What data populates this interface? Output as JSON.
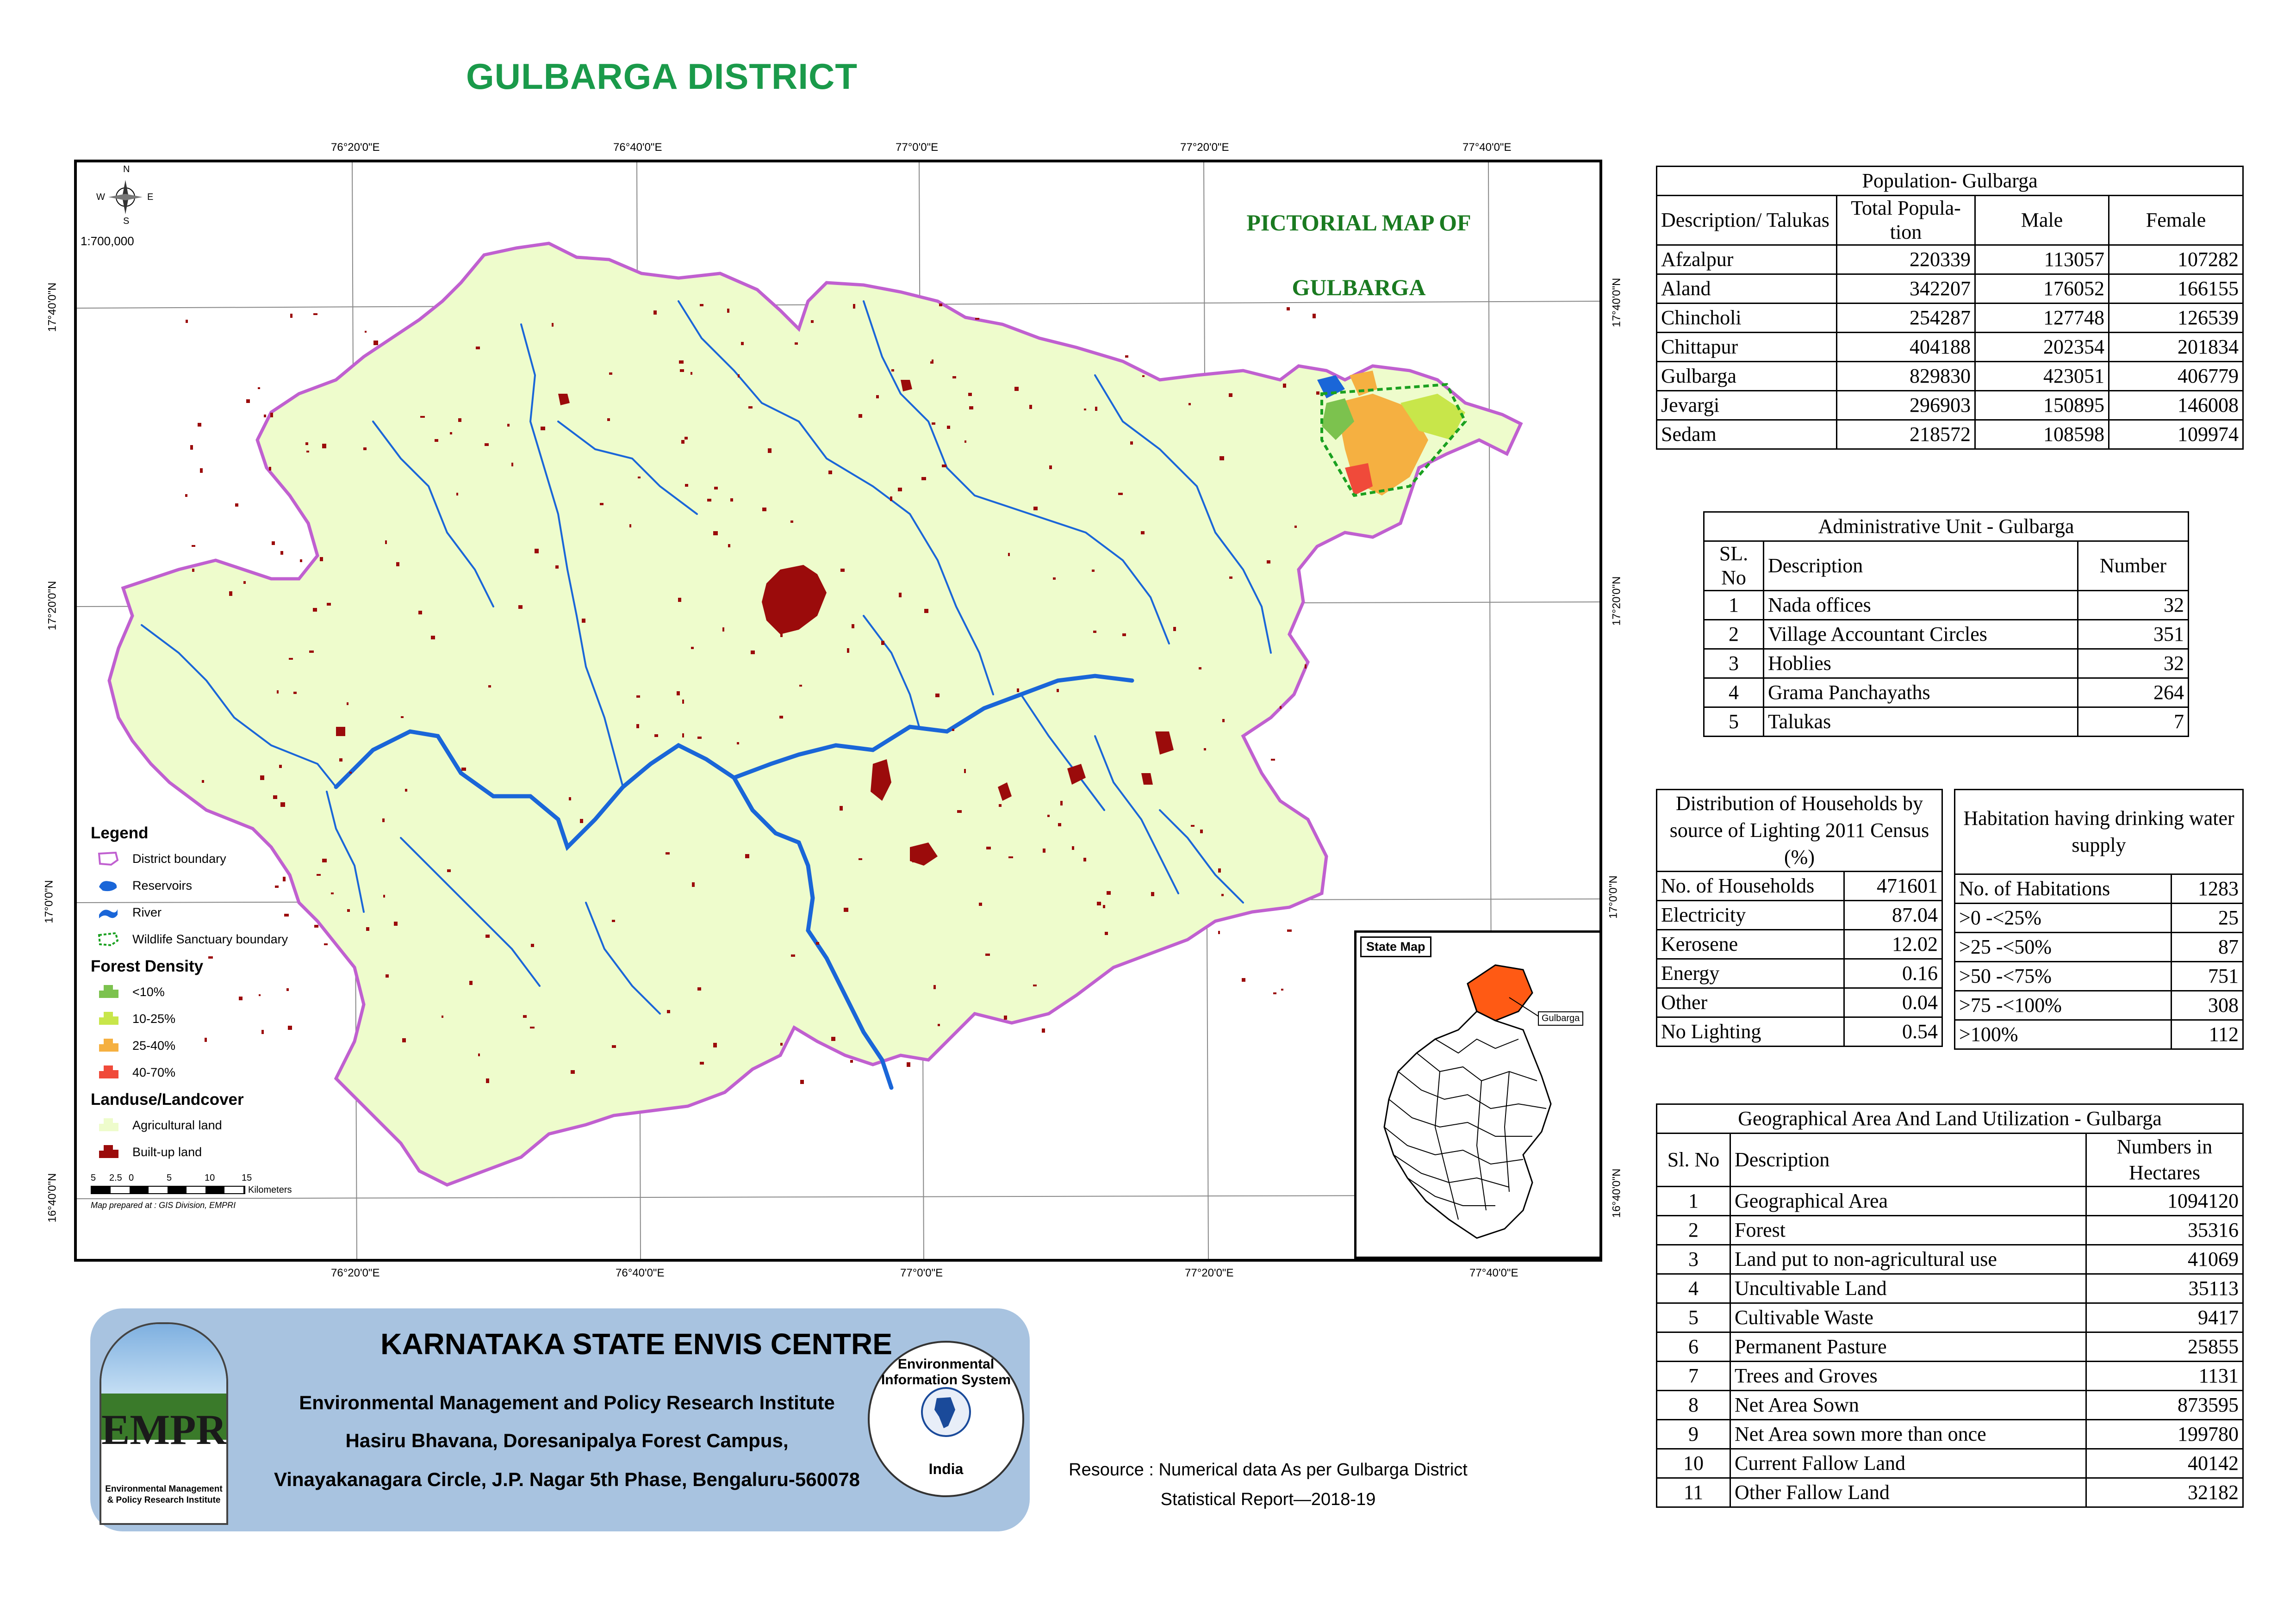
{
  "page_title": "GULBARGA DISTRICT",
  "map": {
    "title_line1": "PICTORIAL MAP OF",
    "title_line2": "GULBARGA",
    "scale": "1:700,000",
    "north_labels": {
      "n": "N",
      "s": "S",
      "e": "E",
      "w": "W"
    },
    "lon_labels": [
      "76°20'0\"E",
      "76°40'0\"E",
      "77°0'0\"E",
      "77°20'0\"E",
      "77°40'0\"E"
    ],
    "lat_labels": [
      "17°40'0\"N",
      "17°20'0\"N",
      "17°0'0\"N",
      "16°40'0\"N"
    ],
    "scalebar_ticks": [
      "5",
      "2.5",
      "0",
      "5",
      "10",
      "15"
    ],
    "scalebar_unit": "Kilometers",
    "prepared_by": "Map prepared at : GIS Division, EMPRI",
    "colors": {
      "district_boundary": "#c060d0",
      "agricultural": "#eefccc",
      "river": "#1a66d8",
      "builtup": "#9b0b0b",
      "forest_low": "#7cc24e",
      "forest_mid": "#c8e64a",
      "forest_25_40": "#f5b041",
      "forest_40_70": "#f04a3a"
    }
  },
  "legend": {
    "title": "Legend",
    "items": [
      {
        "label": "District boundary"
      },
      {
        "label": "Reservoirs"
      },
      {
        "label": "River"
      },
      {
        "label": "Wildlife Sanctuary boundary"
      }
    ],
    "forest_title": "Forest Density",
    "forest_items": [
      {
        "label": "<10%"
      },
      {
        "label": "10-25%"
      },
      {
        "label": "25-40%"
      },
      {
        "label": "40-70%"
      }
    ],
    "landuse_title": "Landuse/Landcover",
    "landuse_items": [
      {
        "label": "Agricultural land"
      },
      {
        "label": "Built-up land"
      }
    ]
  },
  "inset": {
    "title": "State Map",
    "highlight_label": "Gulbarga",
    "highlight_color": "#ff5a14"
  },
  "population": {
    "caption": "Population- Gulbarga",
    "headers": [
      "Description/ Talukas",
      "Total Popula-tion",
      "Male",
      "Female"
    ],
    "rows": [
      [
        "Afzalpur",
        "220339",
        "113057",
        "107282"
      ],
      [
        "Aland",
        "342207",
        "176052",
        "166155"
      ],
      [
        "Chincholi",
        "254287",
        "127748",
        "126539"
      ],
      [
        "Chittapur",
        "404188",
        "202354",
        "201834"
      ],
      [
        "Gulbarga",
        "829830",
        "423051",
        "406779"
      ],
      [
        "Jevargi",
        "296903",
        "150895",
        "146008"
      ],
      [
        "Sedam",
        "218572",
        "108598",
        "109974"
      ]
    ]
  },
  "admin": {
    "caption": "Administrative Unit - Gulbarga",
    "headers": [
      "SL. No",
      "Description",
      "Number"
    ],
    "rows": [
      [
        "1",
        "Nada offices",
        "32"
      ],
      [
        "2",
        "Village Accountant Circles",
        "351"
      ],
      [
        "3",
        "Hoblies",
        "32"
      ],
      [
        "4",
        "Grama Panchayaths",
        "264"
      ],
      [
        "5",
        "Talukas",
        "7"
      ]
    ]
  },
  "households": {
    "caption": "Distribution of Households by source of Lighting 2011 Census (%)",
    "rows": [
      [
        "No. of Households",
        "471601"
      ],
      [
        "Electricity",
        "87.04"
      ],
      [
        "Kerosene",
        "12.02"
      ],
      [
        "Energy",
        "0.16"
      ],
      [
        "Other",
        "0.04"
      ],
      [
        "No Lighting",
        "0.54"
      ]
    ]
  },
  "habitation": {
    "caption": "Habitation having drinking water supply",
    "rows": [
      [
        "No. of Habitations",
        "1283"
      ],
      [
        ">0 -<25%",
        "25"
      ],
      [
        ">25 -<50%",
        "87"
      ],
      [
        ">50 -<75%",
        "751"
      ],
      [
        ">75 -<100%",
        "308"
      ],
      [
        ">100%",
        "112"
      ]
    ]
  },
  "geo": {
    "caption": "Geographical Area  And Land Utilization - Gulbarga",
    "headers": [
      "Sl. No",
      "Description",
      "Numbers in Hectares"
    ],
    "rows": [
      [
        "1",
        "Geographical Area",
        "1094120"
      ],
      [
        "2",
        "Forest",
        "35316"
      ],
      [
        "3",
        "Land put to non-agricultural use",
        "41069"
      ],
      [
        "4",
        "Uncultivable Land",
        "35113"
      ],
      [
        "5",
        "Cultivable Waste",
        "9417"
      ],
      [
        "6",
        "Permanent Pasture",
        "25855"
      ],
      [
        "7",
        "Trees and Groves",
        "1131"
      ],
      [
        "8",
        "Net Area Sown",
        "873595"
      ],
      [
        "9",
        "Net Area sown more than once",
        "199780"
      ],
      [
        "10",
        "Current Fallow Land",
        "40142"
      ],
      [
        "11",
        "Other Fallow Land",
        "32182"
      ]
    ]
  },
  "footer": {
    "title": "KARNATAKA STATE ENVIS CENTRE",
    "line1": "Environmental Management and Policy Research Institute",
    "line2": "Hasiru Bhavana, Doresanipalya Forest Campus,",
    "line3": "Vinayakanagara Circle, J.P. Nagar 5th Phase, Bengaluru-560078",
    "logo_left_text": "EMPRI",
    "logo_left_caption": "Environmental Management & Policy Research Institute",
    "logo_right_text": "Environmental Information System",
    "logo_right_country": "India",
    "resource_line1": "Resource : Numerical data As per Gulbarga District",
    "resource_line2": "Statistical Report—2018-19"
  }
}
